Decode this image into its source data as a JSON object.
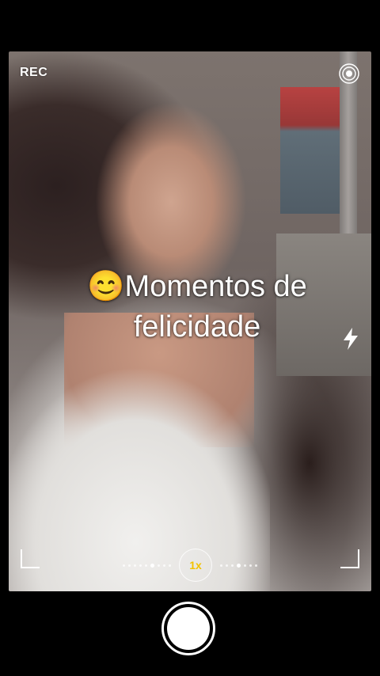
{
  "camera": {
    "rec_label": "REC",
    "caption_emoji": "😊",
    "caption_text": "Momentos de felicidade",
    "zoom_label": "1x",
    "icons": {
      "settings": "settings-target-icon",
      "flash": "lightning-bolt-icon",
      "shutter": "shutter-button-icon"
    },
    "colors": {
      "background": "#000000",
      "zoom_accent": "#f2c200",
      "overlay_text": "#ffffff"
    }
  }
}
